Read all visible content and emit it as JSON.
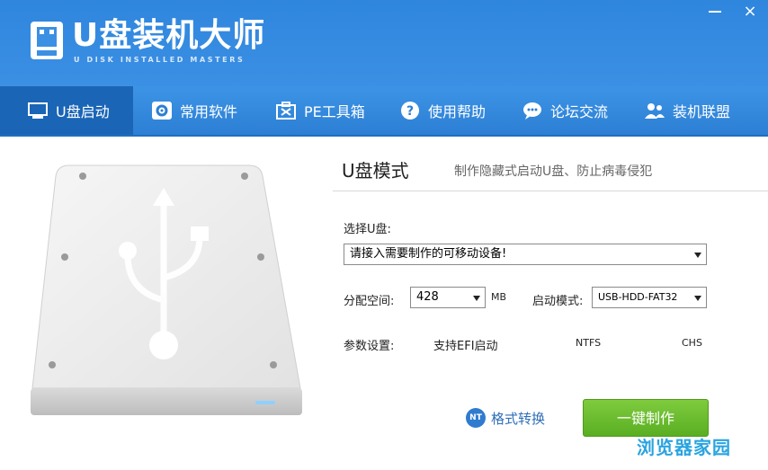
{
  "app": {
    "title": "U盘装机大师",
    "subtitle": "U DISK INSTALLED MASTERS",
    "accent_color": "#2f86dd"
  },
  "window": {
    "minimize_icon": "minimize-icon",
    "close_label": "×"
  },
  "nav": {
    "items": [
      {
        "label": "U盘启动",
        "icon": "usb-drive-icon",
        "active": true
      },
      {
        "label": "常用软件",
        "icon": "gear-icon",
        "active": false
      },
      {
        "label": "PE工具箱",
        "icon": "toolbox-icon",
        "active": false
      },
      {
        "label": "使用帮助",
        "icon": "help-icon",
        "active": false
      },
      {
        "label": "论坛交流",
        "icon": "chat-icon",
        "active": false
      },
      {
        "label": "装机联盟",
        "icon": "users-icon",
        "active": false
      }
    ]
  },
  "main": {
    "mode_title": "U盘模式",
    "mode_desc": "制作隐藏式启动U盘、防止病毒侵犯",
    "select_usb_label": "选择U盘:",
    "usb_device_value": "请接入需要制作的可移动设备!",
    "partition_label": "分配空间:",
    "partition_value": "428",
    "partition_unit": "MB",
    "boot_mode_label": "启动模式:",
    "boot_mode_value": "USB-HDD-FAT32",
    "params_label": "参数设置:",
    "param_efi": "支持EFI启动",
    "param_ntfs": "NTFS",
    "param_chs": "CHS",
    "format_convert_label": "格式转换",
    "nt_badge": "NT",
    "make_button_label": "一键制作",
    "button_color": "#6cbd2e"
  },
  "watermark": "浏览器家园"
}
